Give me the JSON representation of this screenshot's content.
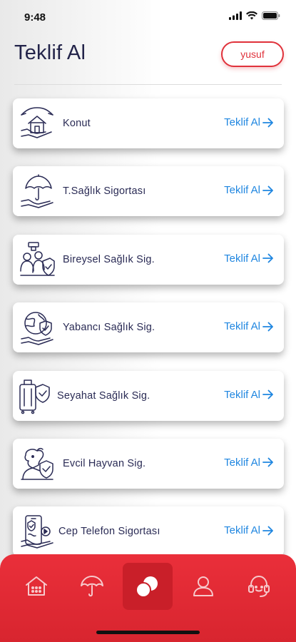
{
  "status": {
    "time": "9:48"
  },
  "header": {
    "title": "Teklif Al",
    "user_label": "yusuf"
  },
  "products": [
    {
      "label": "Konut",
      "action": "Teklif Al",
      "icon": "house-hands-icon"
    },
    {
      "label": "T.Sağlık Sigortası",
      "action": "Teklif Al",
      "icon": "umbrella-hand-icon"
    },
    {
      "label": "Bireysel Sağlık Sig.",
      "action": "Teklif Al",
      "icon": "family-shield-icon"
    },
    {
      "label": "Yabancı Sağlık Sig.",
      "action": "Teklif Al",
      "icon": "globe-shield-icon"
    },
    {
      "label": "Seyahat Sağlık Sig.",
      "action": "Teklif Al",
      "icon": "luggage-shield-icon"
    },
    {
      "label": "Evcil Hayvan Sig.",
      "action": "Teklif Al",
      "icon": "pet-shield-icon"
    },
    {
      "label": "Cep Telefon Sigortası",
      "action": "Teklif Al",
      "icon": "phone-shield-icon"
    }
  ],
  "tabbar": {
    "items": [
      "home-icon",
      "umbrella-icon",
      "products-icon",
      "profile-icon",
      "support-icon"
    ],
    "active": "products-icon"
  },
  "colors": {
    "accent": "#e0323b",
    "link": "#1f86e0",
    "text": "#23244a"
  }
}
